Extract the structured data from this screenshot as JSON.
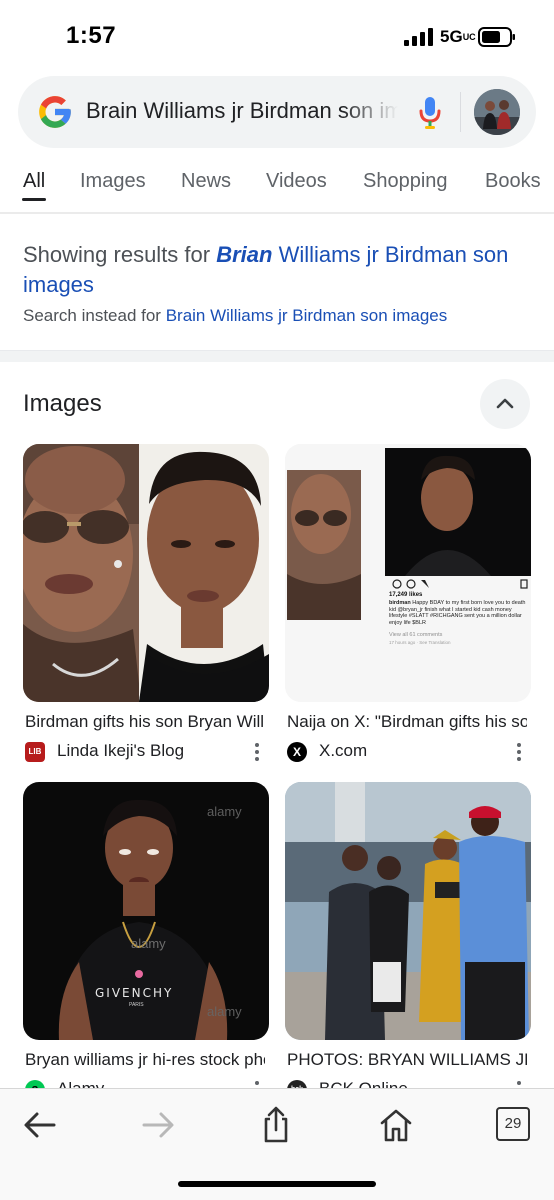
{
  "status": {
    "time": "1:57",
    "network": "5G",
    "network_suffix": "UC"
  },
  "search": {
    "query": "Brain Williams jr Birdman son images"
  },
  "tabs": [
    {
      "label": "All",
      "active": true
    },
    {
      "label": "Images",
      "active": false
    },
    {
      "label": "News",
      "active": false
    },
    {
      "label": "Videos",
      "active": false
    },
    {
      "label": "Shopping",
      "active": false
    },
    {
      "label": "Books",
      "active": false
    }
  ],
  "correction": {
    "prefix": "Showing results for ",
    "corrected_bold": "Brian",
    "corrected_rest": " Williams jr Birdman son images",
    "instead_prefix": "Search instead for ",
    "instead_query": "Brain Williams jr Birdman son images"
  },
  "images_section": {
    "title": "Images",
    "cards": [
      {
        "title": "Birdman gifts his son Bryan Williams jr",
        "source": "Linda Ikeji's Blog",
        "source_icon_text": "LIB",
        "icon": "linda-ikeji-logo-icon"
      },
      {
        "title": "Naija on X: \"Birdman gifts his son",
        "source": "X.com",
        "source_icon_text": "X",
        "icon": "x-logo-icon"
      },
      {
        "title": "Bryan williams jr hi-res stock photography",
        "source": "Alamy",
        "source_icon_text": "a",
        "icon": "alamy-logo-icon"
      },
      {
        "title": "PHOTOS: BRYAN WILLIAMS JR",
        "source": "BCK Online",
        "source_icon_text": "bck",
        "icon": "bck-logo-icon"
      }
    ],
    "post_caption": {
      "likes": "17,249 likes",
      "user": "birdman",
      "text": "Happy BDAY to my first born love you to death kid @bryan_jr finish what I started kid cash money lifestyle #SLATT #RICHGANG sent you a million dollar enjoy life $BLR",
      "comments": "View all 61 comments",
      "time": "17 hours ago",
      "translation": "See Translation"
    },
    "watermark": "alamy",
    "shirt_text": "GIVENCHY",
    "shirt_subtext": "PARIS"
  },
  "toolbar": {
    "tabs_count": "29"
  },
  "colors": {
    "link_blue": "#1a4fb5",
    "google_blue": "#4285f4",
    "google_red": "#ea4335",
    "google_yellow": "#fbbc05",
    "google_green": "#34a853"
  }
}
